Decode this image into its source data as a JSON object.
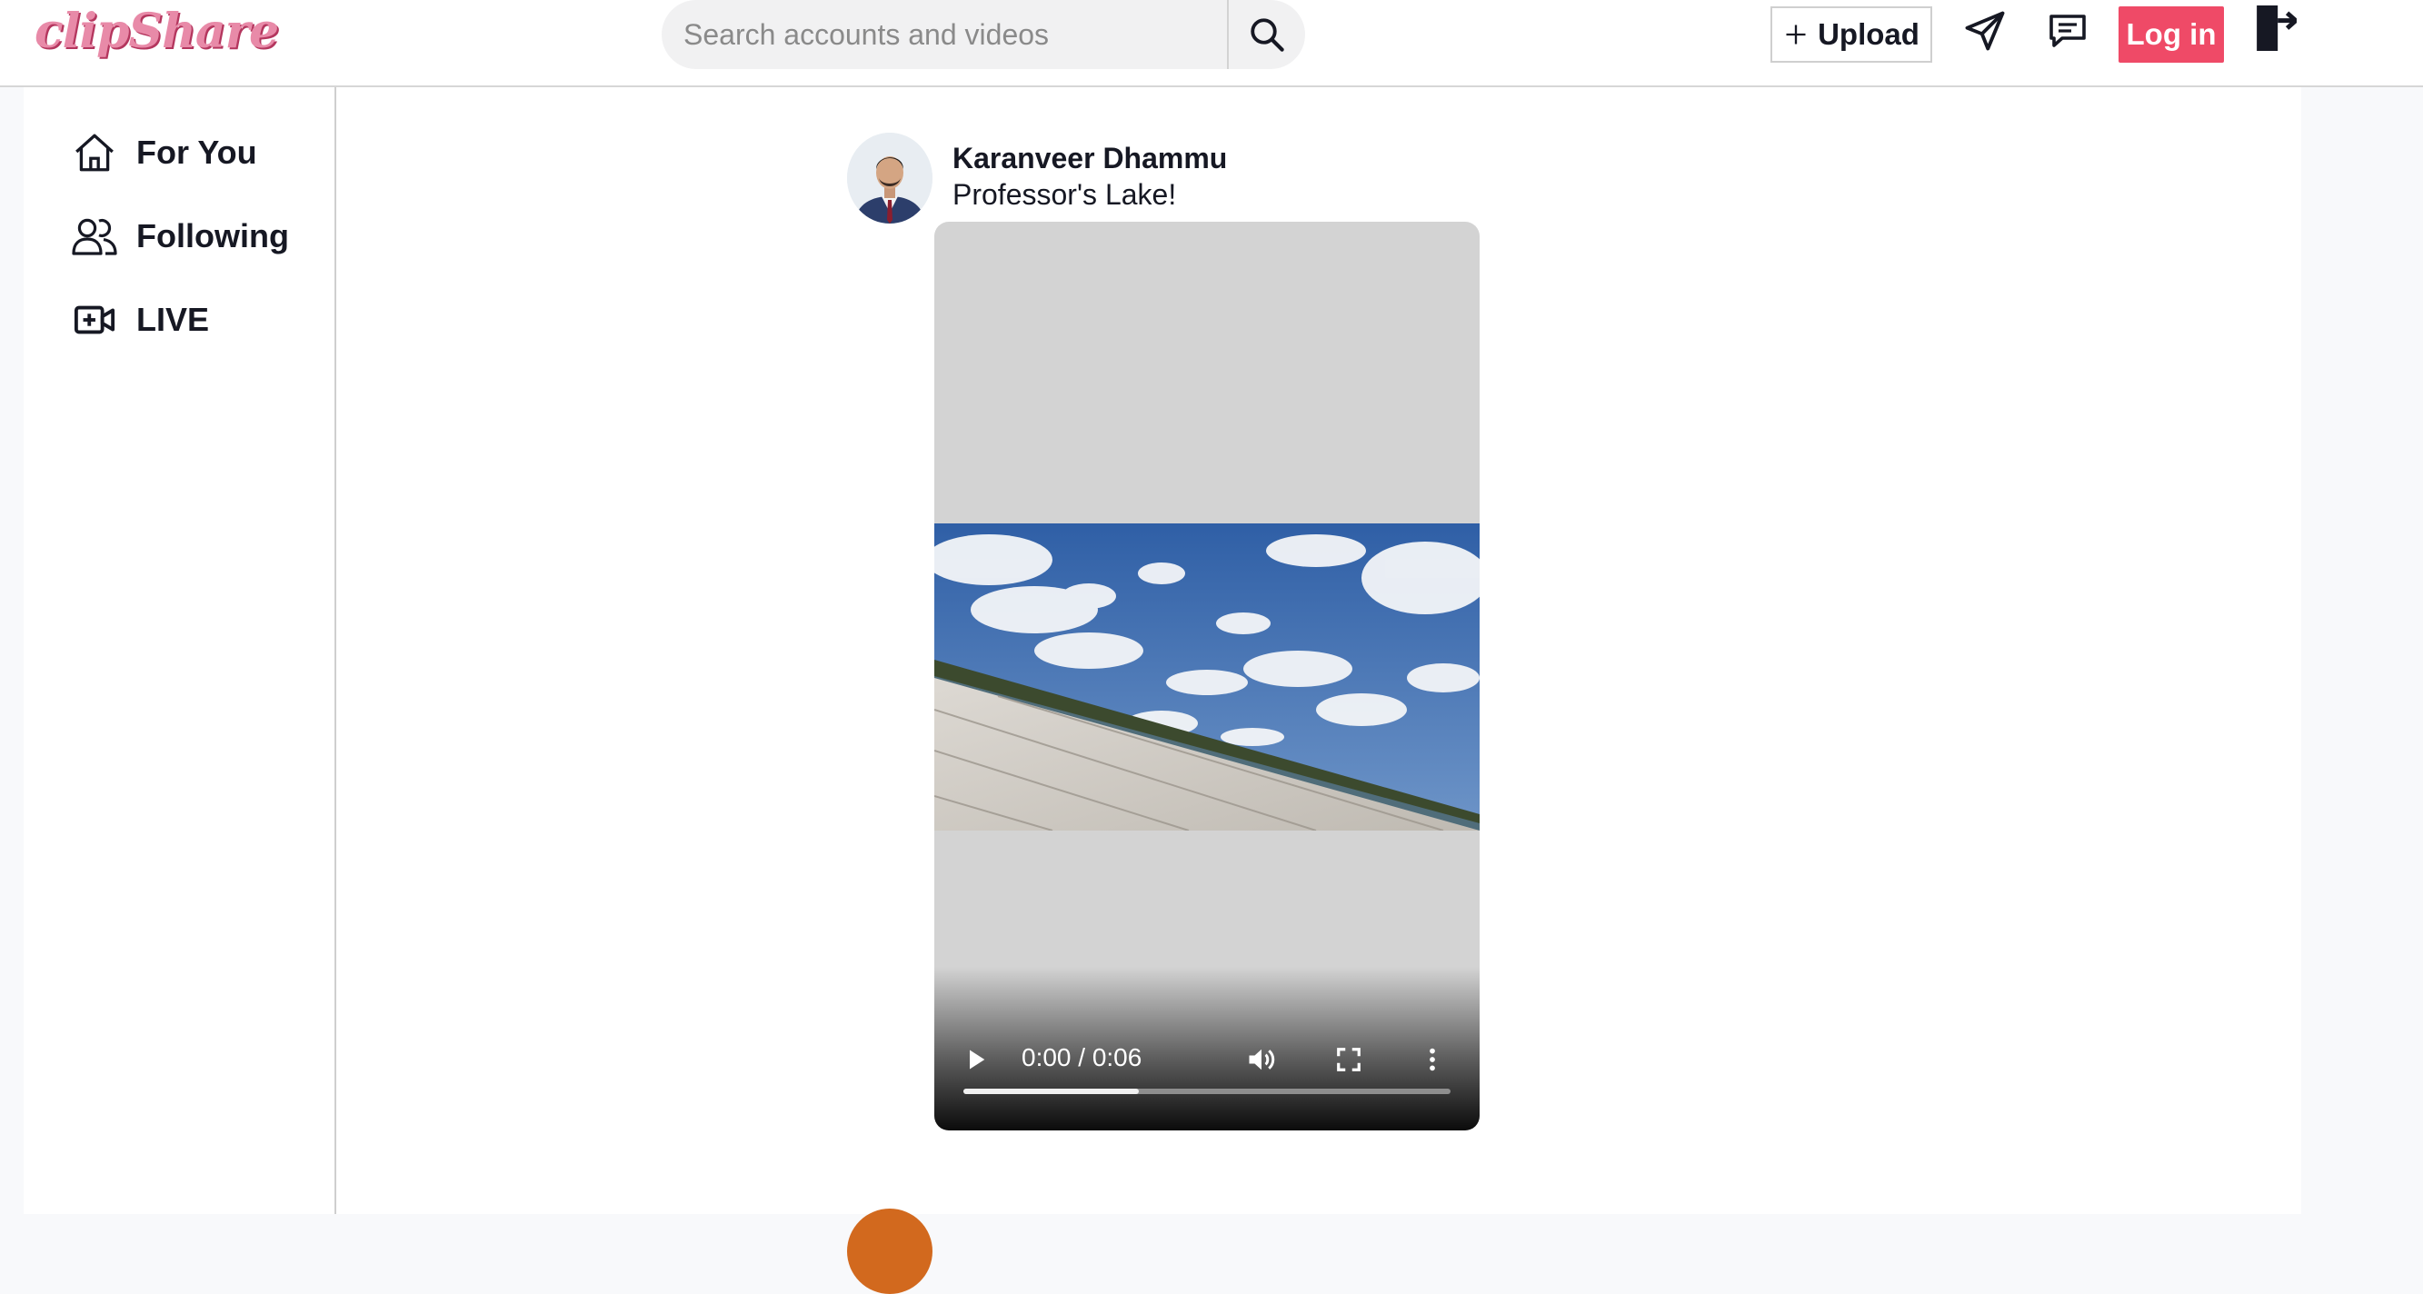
{
  "header": {
    "logo_text": "clipShare",
    "search": {
      "placeholder": "Search accounts and videos",
      "value": ""
    },
    "upload_label": "Upload",
    "login_label": "Log in",
    "icons": [
      "search-icon",
      "plus-icon",
      "send-icon",
      "message-icon",
      "logout-icon"
    ]
  },
  "sidebar": {
    "items": [
      {
        "label": "For You",
        "icon": "home-icon"
      },
      {
        "label": "Following",
        "icon": "users-icon"
      },
      {
        "label": "LIVE",
        "icon": "live-video-icon"
      }
    ]
  },
  "post": {
    "author": "Karanveer Dhammu",
    "caption": "Professor's Lake!",
    "video": {
      "time": "0:00 / 0:06",
      "buffered_fraction": 0.36
    }
  },
  "colors": {
    "brand": "#ef4a67",
    "logo": "#e88aa8",
    "text": "#161823"
  }
}
